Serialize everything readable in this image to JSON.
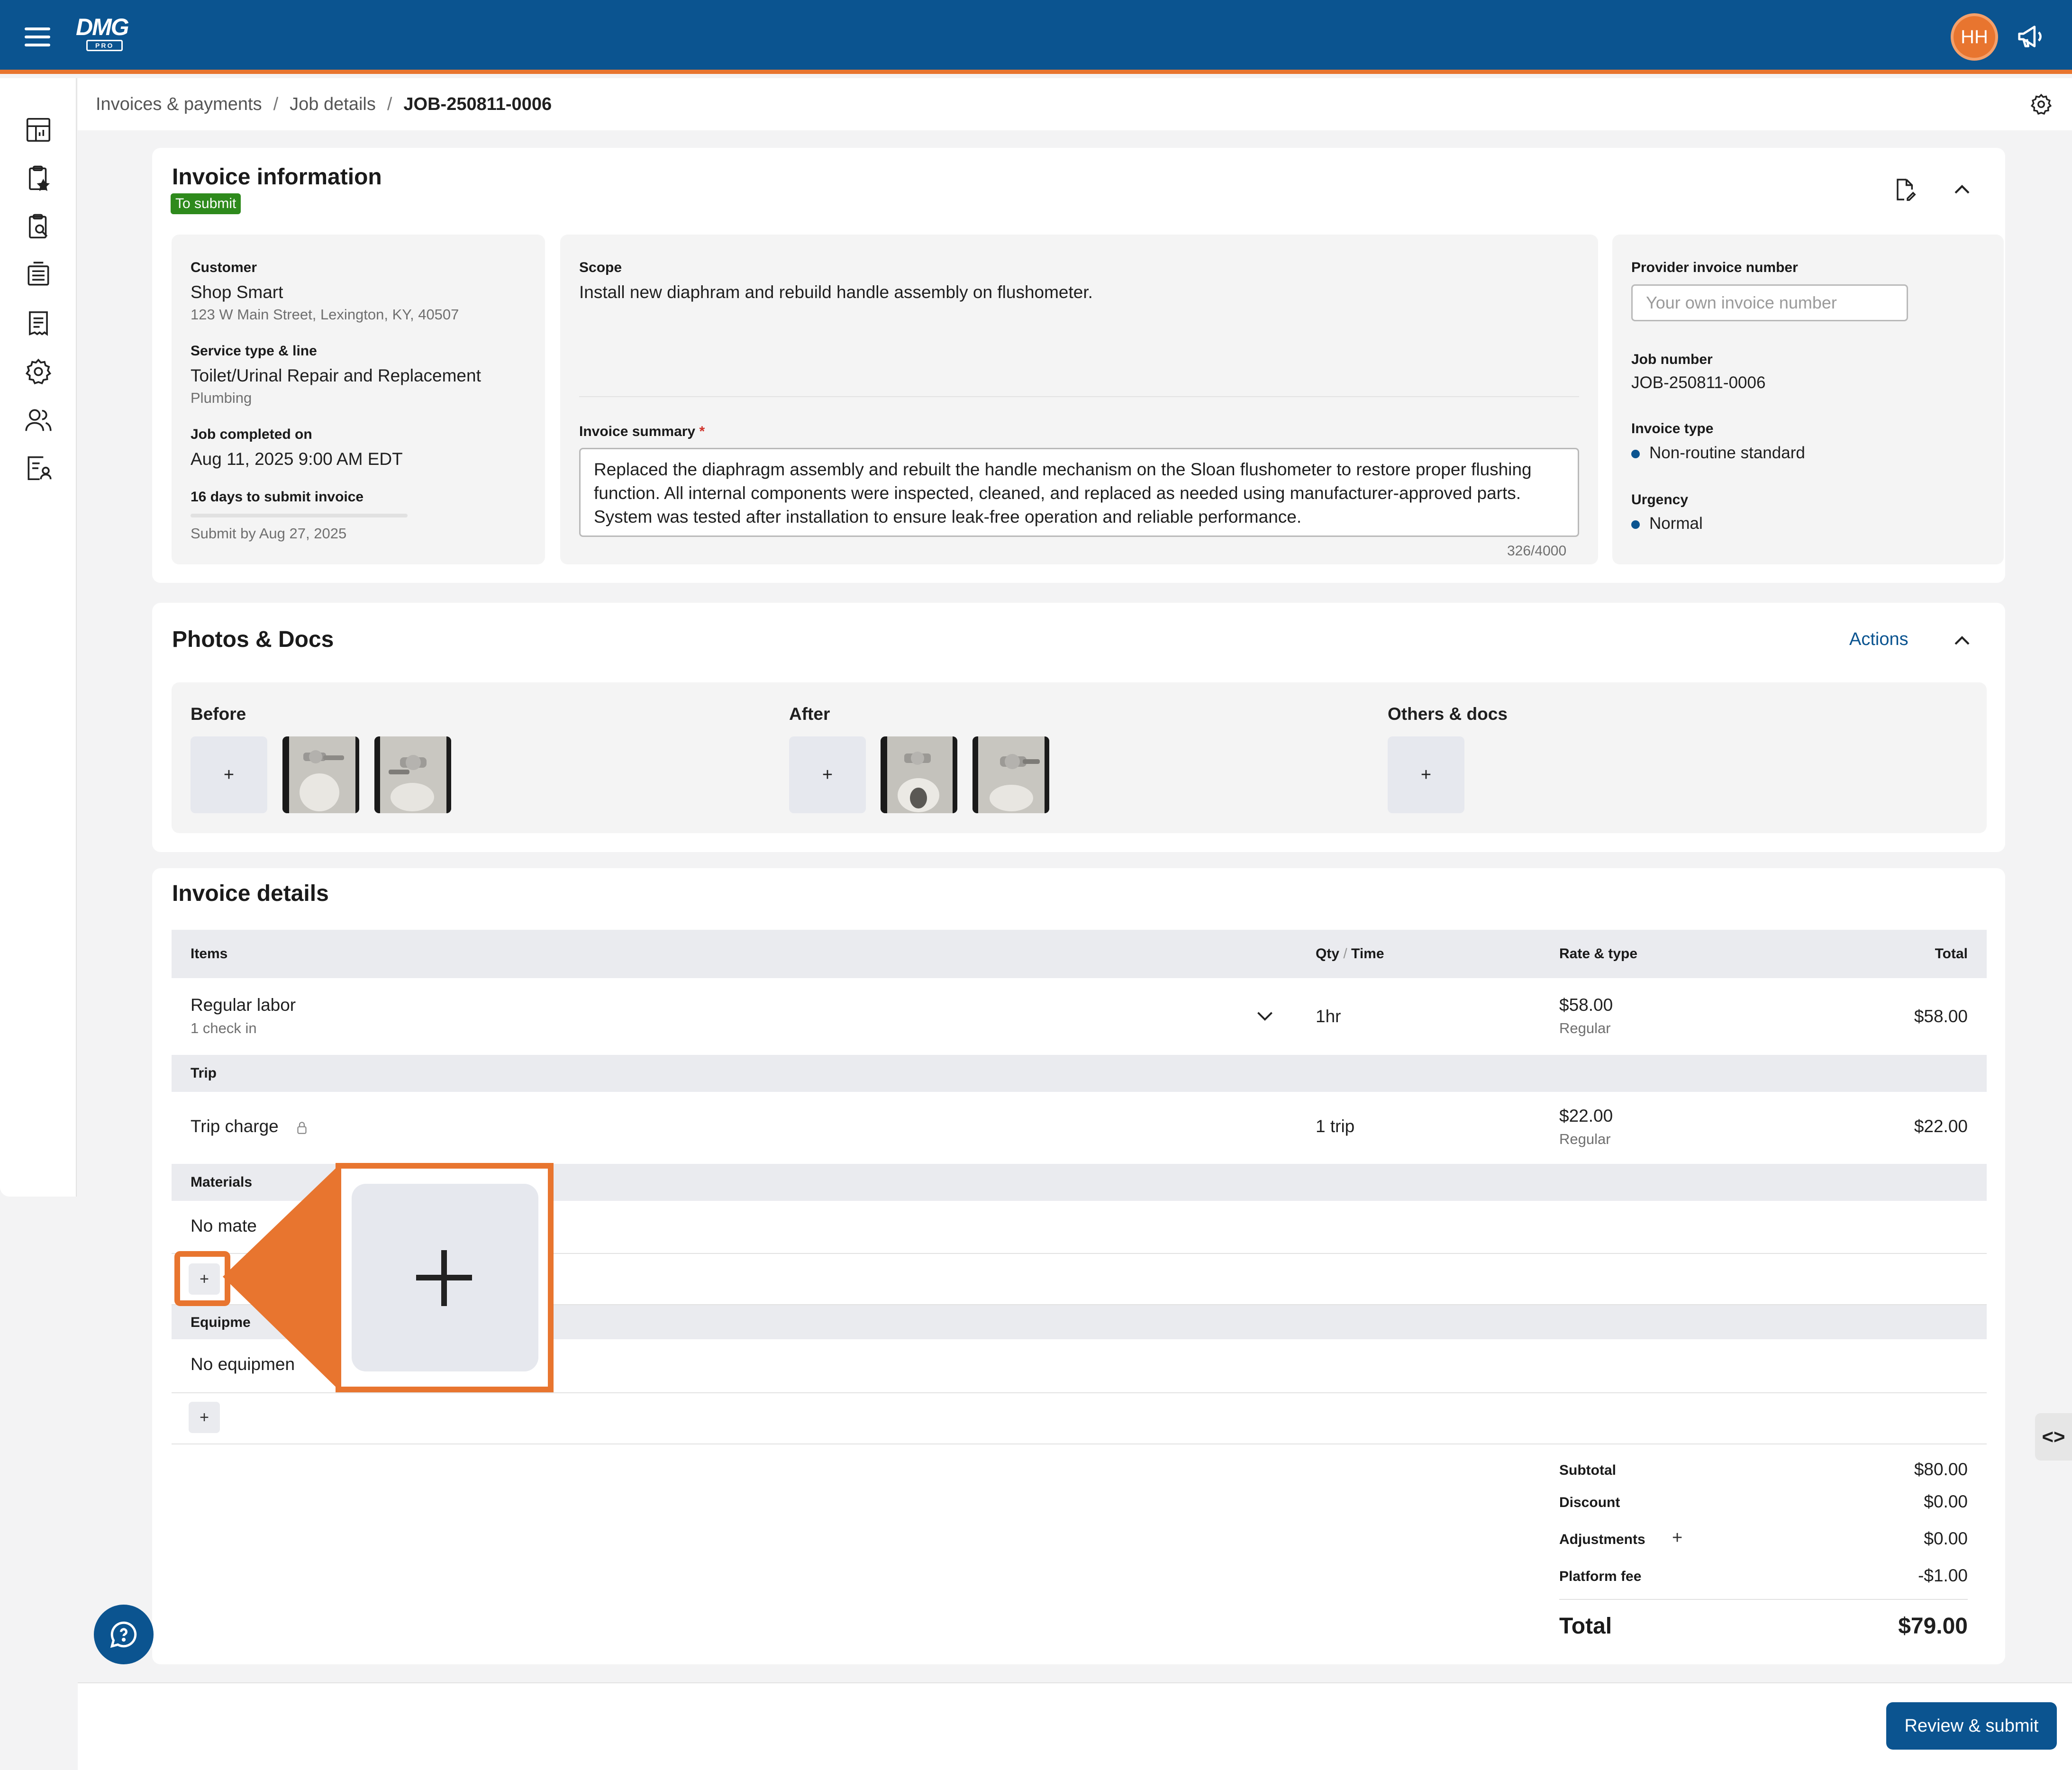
{
  "header": {
    "logo_text": "DMG",
    "logo_sub": "PRO",
    "avatar_initials": "HH"
  },
  "breadcrumb": {
    "items": [
      "Invoices & payments",
      "Job details"
    ],
    "current": "JOB-250811-0006"
  },
  "invoice_info": {
    "title": "Invoice information",
    "status_badge": "To submit",
    "customer_label": "Customer",
    "customer_name": "Shop Smart",
    "customer_address": "123 W Main Street, Lexington, KY, 40507",
    "service_label": "Service type & line",
    "service_type": "Toilet/Urinal Repair and Replacement",
    "service_line": "Plumbing",
    "completed_label": "Job completed on",
    "completed_value": "Aug 11, 2025 9:00 AM EDT",
    "days_label": "16 days to submit invoice",
    "submit_by": "Submit by Aug 27, 2025",
    "scope_label": "Scope",
    "scope_text": "Install new diaphram and rebuild handle assembly on flushometer.",
    "summary_label": "Invoice summary",
    "summary_required": "*",
    "summary_text": "Replaced the diaphragm assembly and rebuilt the handle mechanism on the Sloan flushometer to restore proper flushing function. All internal components were inspected, cleaned, and replaced as needed using manufacturer-approved parts. System was tested after installation to ensure leak-free operation and reliable performance.",
    "summary_count": "326/4000",
    "provider_label": "Provider invoice number",
    "provider_placeholder": "Your own invoice number",
    "job_number_label": "Job number",
    "job_number": "JOB-250811-0006",
    "invoice_type_label": "Invoice type",
    "invoice_type": "Non-routine standard",
    "urgency_label": "Urgency",
    "urgency": "Normal"
  },
  "photos": {
    "title": "Photos & Docs",
    "actions_label": "Actions",
    "before_label": "Before",
    "after_label": "After",
    "others_label": "Others & docs",
    "add_symbol": "+"
  },
  "details": {
    "title": "Invoice details",
    "col_items": "Items",
    "col_qty": "Qty",
    "col_qty_sep": "/",
    "col_time": "Time",
    "col_rate": "Rate & type",
    "col_total": "Total",
    "labor_name": "Regular labor",
    "labor_sub": "1 check in",
    "labor_qty": "1hr",
    "labor_rate": "$58.00",
    "labor_rate_type": "Regular",
    "labor_total": "$58.00",
    "trip_section": "Trip",
    "trip_name": "Trip charge",
    "trip_qty": "1 trip",
    "trip_rate": "$22.00",
    "trip_rate_type": "Regular",
    "trip_total": "$22.00",
    "materials_section": "Materials",
    "materials_empty": "No mate",
    "equipment_section": "Equipme",
    "equipment_empty": "No equipmen",
    "add_symbol": "+",
    "subtotal_label": "Subtotal",
    "subtotal": "$80.00",
    "discount_label": "Discount",
    "discount": "$0.00",
    "adjustments_label": "Adjustments",
    "adjustments_add": "+",
    "adjustments": "$0.00",
    "platform_label": "Platform fee",
    "platform": "-$1.00",
    "total_label": "Total",
    "total": "$79.00"
  },
  "footer": {
    "submit_label": "Review & submit",
    "code_toggle": "<>"
  },
  "colors": {
    "brand_blue": "#0b5490",
    "accent_orange": "#e8752f",
    "status_green": "#2e8a1c"
  },
  "icons": [
    "menu-icon",
    "megaphone-icon",
    "settings-icon",
    "document-edit-icon",
    "chevron-up-icon",
    "chevron-down-icon",
    "lock-icon",
    "help-chat-icon"
  ]
}
